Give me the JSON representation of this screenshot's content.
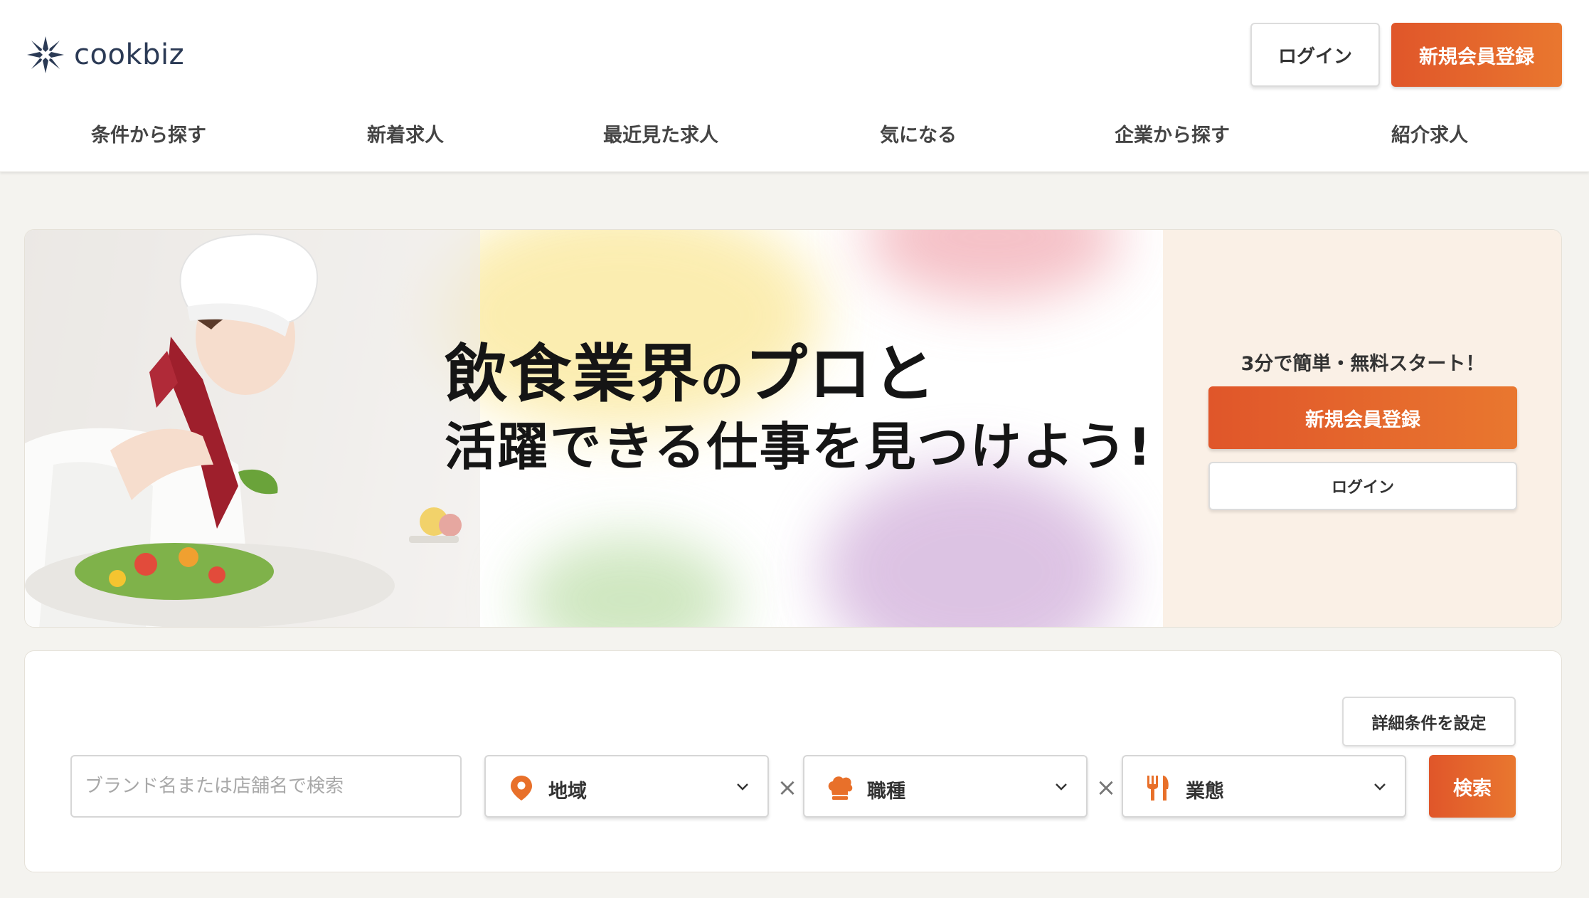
{
  "header": {
    "logo_text": "cookbiz",
    "login_label": "ログイン",
    "signup_label": "新規会員登録"
  },
  "nav": {
    "items": [
      {
        "label": "条件から探す"
      },
      {
        "label": "新着求人"
      },
      {
        "label": "最近見た求人"
      },
      {
        "label": "気になる"
      },
      {
        "label": "企業から探す"
      },
      {
        "label": "紹介求人"
      }
    ]
  },
  "hero": {
    "title_part1": "飲食業界",
    "title_part2": "の",
    "title_part3": "プロと",
    "title_line2": "活躍できる仕事を見つけよう!",
    "side_caption": "3分で簡単・無料スタート！",
    "side_signup_label": "新規会員登録",
    "side_login_label": "ログイン"
  },
  "search": {
    "detail_button_label": "詳細条件を設定",
    "keyword_placeholder": "ブランド名または店舗名で検索",
    "keyword_value": "",
    "area_label": "地域",
    "job_label": "職種",
    "business_label": "業態",
    "separator": "×",
    "submit_label": "検索"
  },
  "colors": {
    "accent": "#e0562a",
    "accent_end": "#e9772f",
    "icon_orange": "#e8702a",
    "logo_navy": "#2b3a55",
    "side_bg": "#faf0e6",
    "page_bg": "#f4f3ef"
  },
  "icons": {
    "logo": "sparkle-star-icon",
    "area": "map-pin-icon",
    "job": "chef-hat-icon",
    "business": "fork-knife-icon",
    "dropdown": "chevron-down-icon"
  }
}
